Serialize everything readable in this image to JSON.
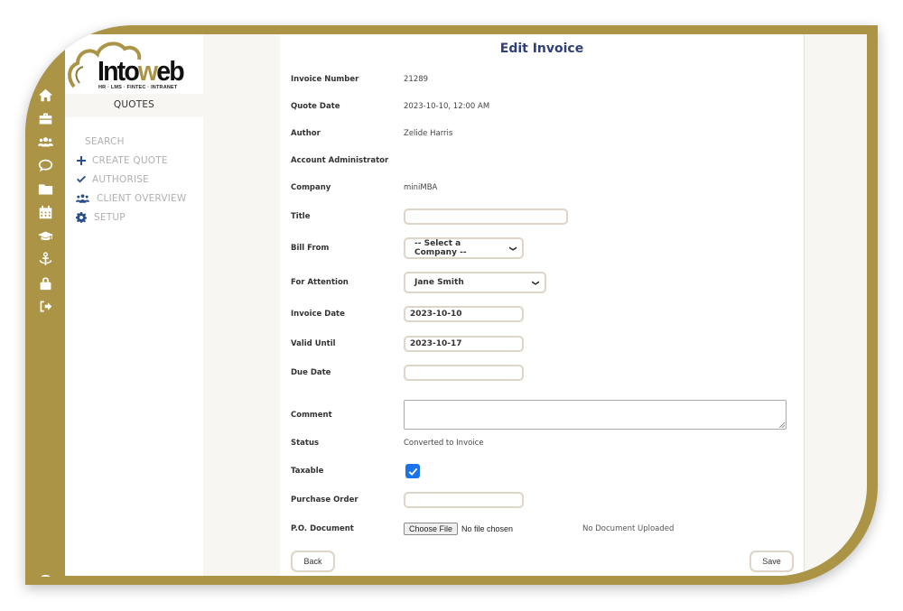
{
  "brand": {
    "logo_text_a": "Into",
    "logo_text_w": "w",
    "logo_text_b": "eb",
    "tagline": "HR · LMS · FINTEC · INTRANET",
    "accent_color": "#ab9445"
  },
  "rail": {
    "icons": [
      "home-icon",
      "briefcase-icon",
      "users-icon",
      "chat-icon",
      "folder-icon",
      "calendar-icon",
      "graduation-cap-icon",
      "anchor-icon",
      "lock-icon",
      "sign-out-icon"
    ]
  },
  "sidebar": {
    "title": "QUOTES",
    "items": [
      {
        "label": "SEARCH",
        "icon": ""
      },
      {
        "label": "CREATE QUOTE",
        "icon": "plus-icon"
      },
      {
        "label": "AUTHORISE",
        "icon": "check-icon"
      },
      {
        "label": "CLIENT OVERVIEW",
        "icon": "users-icon"
      },
      {
        "label": "SETUP",
        "icon": "gear-icon"
      }
    ]
  },
  "form": {
    "title": "Edit Invoice",
    "invoice_number": {
      "label": "Invoice Number",
      "value": "21289"
    },
    "quote_date": {
      "label": "Quote Date",
      "value": "2023-10-10, 12:00 AM"
    },
    "author": {
      "label": "Author",
      "value": "Zelide Harris"
    },
    "account_admin": {
      "label": "Account Administrator",
      "value": ""
    },
    "company": {
      "label": "Company",
      "value": "miniMBA"
    },
    "title_field": {
      "label": "Title",
      "value": ""
    },
    "bill_from": {
      "label": "Bill From",
      "value": "-- Select a Company --"
    },
    "for_attention": {
      "label": "For Attention",
      "value": "Jane Smith"
    },
    "invoice_date": {
      "label": "Invoice Date",
      "value": "2023-10-10"
    },
    "valid_until": {
      "label": "Valid Until",
      "value": "2023-10-17"
    },
    "due_date": {
      "label": "Due Date",
      "value": ""
    },
    "comment": {
      "label": "Comment",
      "value": ""
    },
    "status": {
      "label": "Status",
      "value": "Converted to Invoice"
    },
    "taxable": {
      "label": "Taxable",
      "checked": true
    },
    "purchase_order": {
      "label": "Purchase Order",
      "value": ""
    },
    "po_document": {
      "label": "P.O. Document",
      "button": "Choose File",
      "file_status": "No file chosen",
      "upload_status": "No Document Uploaded"
    },
    "back_label": "Back",
    "save_label": "Save"
  }
}
